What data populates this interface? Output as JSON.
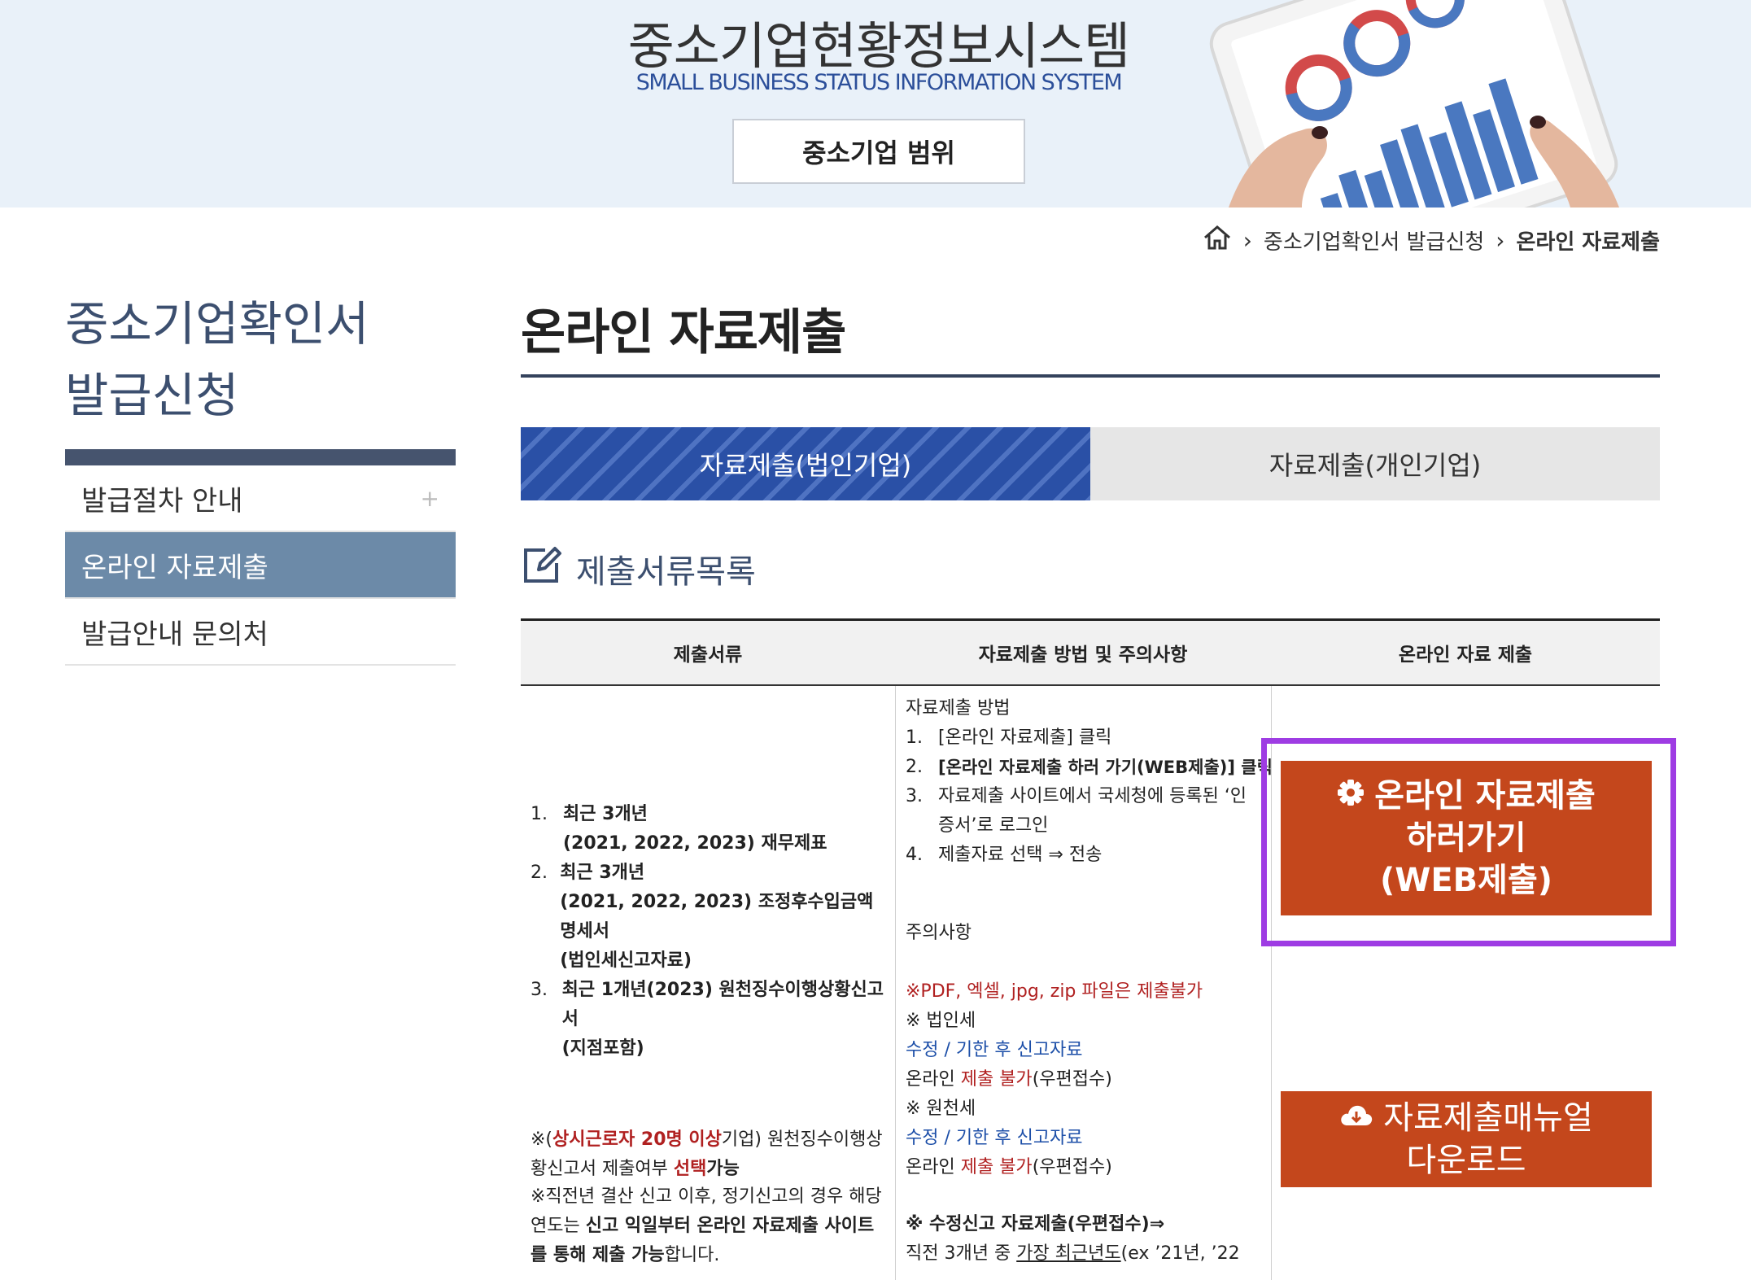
{
  "banner": {
    "title": "중소기업현황정보시스템",
    "subtitle": "SMALL BUSINESS STATUS INFORMATION SYSTEM",
    "scope_button": "중소기업 범위"
  },
  "breadcrumb": {
    "home_icon": "home-icon",
    "items": [
      "중소기업확인서 발급신청",
      "온라인 자료제출"
    ]
  },
  "sidebar": {
    "title_line1": "중소기업확인서",
    "title_line2": "발급신청",
    "items": [
      {
        "label": "발급절차 안내",
        "suffix": "+"
      },
      {
        "label": "온라인 자료제출"
      },
      {
        "label": "발급안내 문의처"
      }
    ]
  },
  "page": {
    "title": "온라인 자료제출"
  },
  "tabs": [
    {
      "label": "자료제출(법인기업)",
      "active": true
    },
    {
      "label": "자료제출(개인기업)",
      "active": false
    }
  ],
  "section": {
    "heading": "제출서류목록",
    "icon": "edit-icon"
  },
  "table": {
    "headers": [
      "제출서류",
      "자료제출 방법 및 주의사항",
      "온라인 자료 제출"
    ],
    "documents": [
      {
        "num": "1.",
        "line1": "최근 3개년",
        "line2": "(2021, 2022, 2023) 재무제표"
      },
      {
        "num": "2.",
        "line1": "최근 3개년",
        "line2": "(2021, 2022, 2023) 조정후수입금액명세서",
        "line3": "(법인세신고자료)"
      },
      {
        "num": "3.",
        "line1": "최근 1개년(2023) 원천징수이행상황신고서",
        "line2": "(지점포함)"
      }
    ],
    "note1": {
      "prefix": "※(",
      "red1": "상시근로자 20명 이상",
      "mid1": "기업) 원천징수이행상황신고서 제출여부 ",
      "red2": "선택",
      "suffix": "가능"
    },
    "note2": {
      "prefix": "※직전년 결산 신고 이후, 정기신고의 경우 해당연도는 ",
      "bold": "신고 익일부터 온라인 자료제출 사이트를 통해 제출 가능",
      "suffix": "합니다."
    },
    "method": {
      "heading": "자료제출 방법",
      "steps": [
        {
          "num": "1.",
          "text": "[온라인 자료제출] 클릭"
        },
        {
          "num": "2.",
          "text": "[온라인 자료제출 하러 가기(WEB제출)] 클릭"
        },
        {
          "num": "3.",
          "text": "자료제출 사이트에서 국세청에 등록된 ‘인증서’로 로그인"
        },
        {
          "num": "4.",
          "text": "제출자료 선택 ⇒ 전송"
        }
      ]
    },
    "caution": {
      "heading": "주의사항",
      "warning": "※PDF, 엑셀, jpg, zip 파일은 제출불가",
      "corp_tax": "※ 법인세",
      "corp_tax_item": "수정 / 기한 후 신고자료",
      "corp_tax_online": "온라인 ",
      "corp_tax_no": "제출 불가",
      "corp_tax_post": "(우편접수)",
      "withholding": "※ 원천세",
      "withholding_item": "수정 / 기한 후 신고자료",
      "withholding_online": "온라인 ",
      "withholding_no": "제출 불가",
      "withholding_post": "(우편접수)",
      "amend_heading": "※ 수정신고 자료제출(우편접수)⇒",
      "amend_text1": "직전 3개년 중 ",
      "amend_underline": "가장 최근년도",
      "amend_text2": "(ex ’21년, ’22"
    },
    "actions": {
      "web_submit_icon": "gear-icon",
      "web_submit_line1": "온라인 자료제출",
      "web_submit_line2": "하러가기",
      "web_submit_line3": "(WEB제출)",
      "manual_icon": "cloud-download-icon",
      "manual_line1": "자료제출매뉴얼",
      "manual_line2": "다운로드"
    }
  },
  "colors": {
    "accent_orange": "#c4471c",
    "tab_blue": "#2a50a6",
    "highlight": "#9e3ce3",
    "nav_active": "#6c8aa8"
  }
}
